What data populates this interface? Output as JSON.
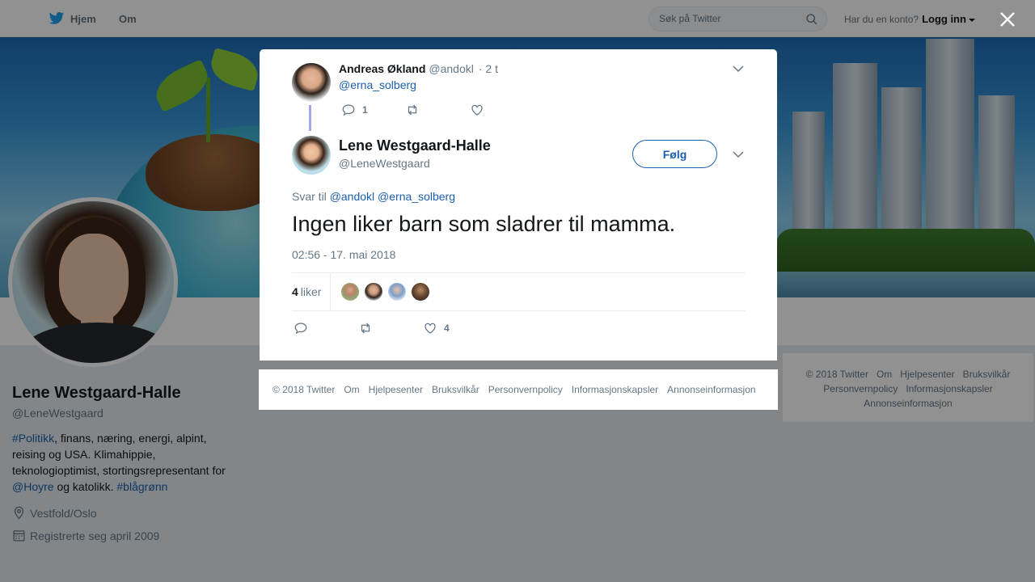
{
  "topbar": {
    "home_label": "Hjem",
    "about_label": "Om",
    "search_placeholder": "Søk på Twitter",
    "account_prompt": "Har du en konto?",
    "login_label": "Logg inn"
  },
  "profile": {
    "name": "Lene Westgaard-Halle",
    "handle": "@LeneWestgaard",
    "bio": {
      "tag_politics": "#Politikk",
      "text_1": ", finans, næring, energi, alpint, reising og USA. Klimahippie, teknologioptimist, stortingsrepresentant for ",
      "mention_hoyre": "@Hoyre",
      "text_2": " og katolikk. ",
      "tag_blagronn": "#blågrønn"
    },
    "location": "Vestfold/Oslo",
    "joined": "Registrerte seg april 2009"
  },
  "side_footer": {
    "line1": [
      "© 2018 Twitter",
      "Om",
      "Hjelpesenter",
      "Bruksvilkår"
    ],
    "line2": [
      "Personvernpolicy",
      "Informasjonskapsler"
    ],
    "line3": [
      "Annonseinformasjon"
    ]
  },
  "modal": {
    "parent_tweet": {
      "name": "Andreas Økland",
      "handle": "@andokl",
      "time": "· 2 t",
      "text": "@erna_solberg",
      "reply_count": "1"
    },
    "main_tweet": {
      "name": "Lene Westgaard-Halle",
      "handle": "@LeneWestgaard",
      "follow_label": "Følg",
      "reply_prefix": "Svar til",
      "reply_mention_1": "@andokl",
      "reply_mention_2": "@erna_solberg",
      "text": "Ingen liker barn som sladrer til mamma.",
      "timestamp": "02:56 - 17. mai 2018",
      "likes_count": "4",
      "likes_label": "liker",
      "like_action_count": "4"
    }
  },
  "modal_footer": {
    "items": [
      "© 2018 Twitter",
      "Om",
      "Hjelpesenter",
      "Bruksvilkår",
      "Personvernpolicy",
      "Informasjonskapsler",
      "Annonseinformasjon"
    ]
  },
  "colors": {
    "link": "#1b5faa",
    "overlay": "rgba(0,0,0,0.43)",
    "thread_line": "#a4a5f0",
    "muted_text": "#657786"
  }
}
